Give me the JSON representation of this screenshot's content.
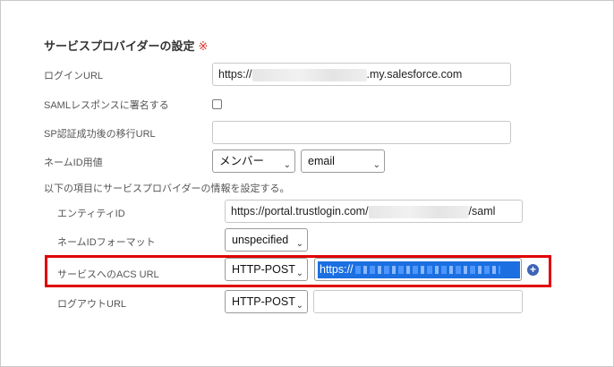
{
  "section": {
    "title": "サービスプロバイダーの設定",
    "required_mark": "※"
  },
  "login_url": {
    "label": "ログインURL",
    "prefix": "https://",
    "suffix": ".my.salesforce.com"
  },
  "saml_sign": {
    "label": "SAMLレスポンスに署名する",
    "checked": false
  },
  "sp_redirect": {
    "label": "SP認証成功後の移行URL",
    "value": ""
  },
  "name_id_usage": {
    "label": "ネームID用値",
    "select1": "メンバー",
    "select2": "email"
  },
  "provider_info": {
    "text": "以下の項目にサービスプロバイダーの情報を設定する。"
  },
  "entity_id": {
    "label": "エンティティID",
    "prefix": "https://portal.trustlogin.com/",
    "suffix": "/saml"
  },
  "name_id_format": {
    "label": "ネームIDフォーマット",
    "value": "unspecified"
  },
  "acs_url": {
    "label": "サービスへのACS URL",
    "method": "HTTP-POST",
    "value_prefix": "https://",
    "highlight_color": "#e00000",
    "selection_color": "#1b6fe0"
  },
  "logout_url": {
    "label": "ログアウトURL",
    "method": "HTTP-POST",
    "value": ""
  },
  "icons": {
    "add": "plus-circle-icon",
    "dropdown": "chevron-down-icon"
  }
}
